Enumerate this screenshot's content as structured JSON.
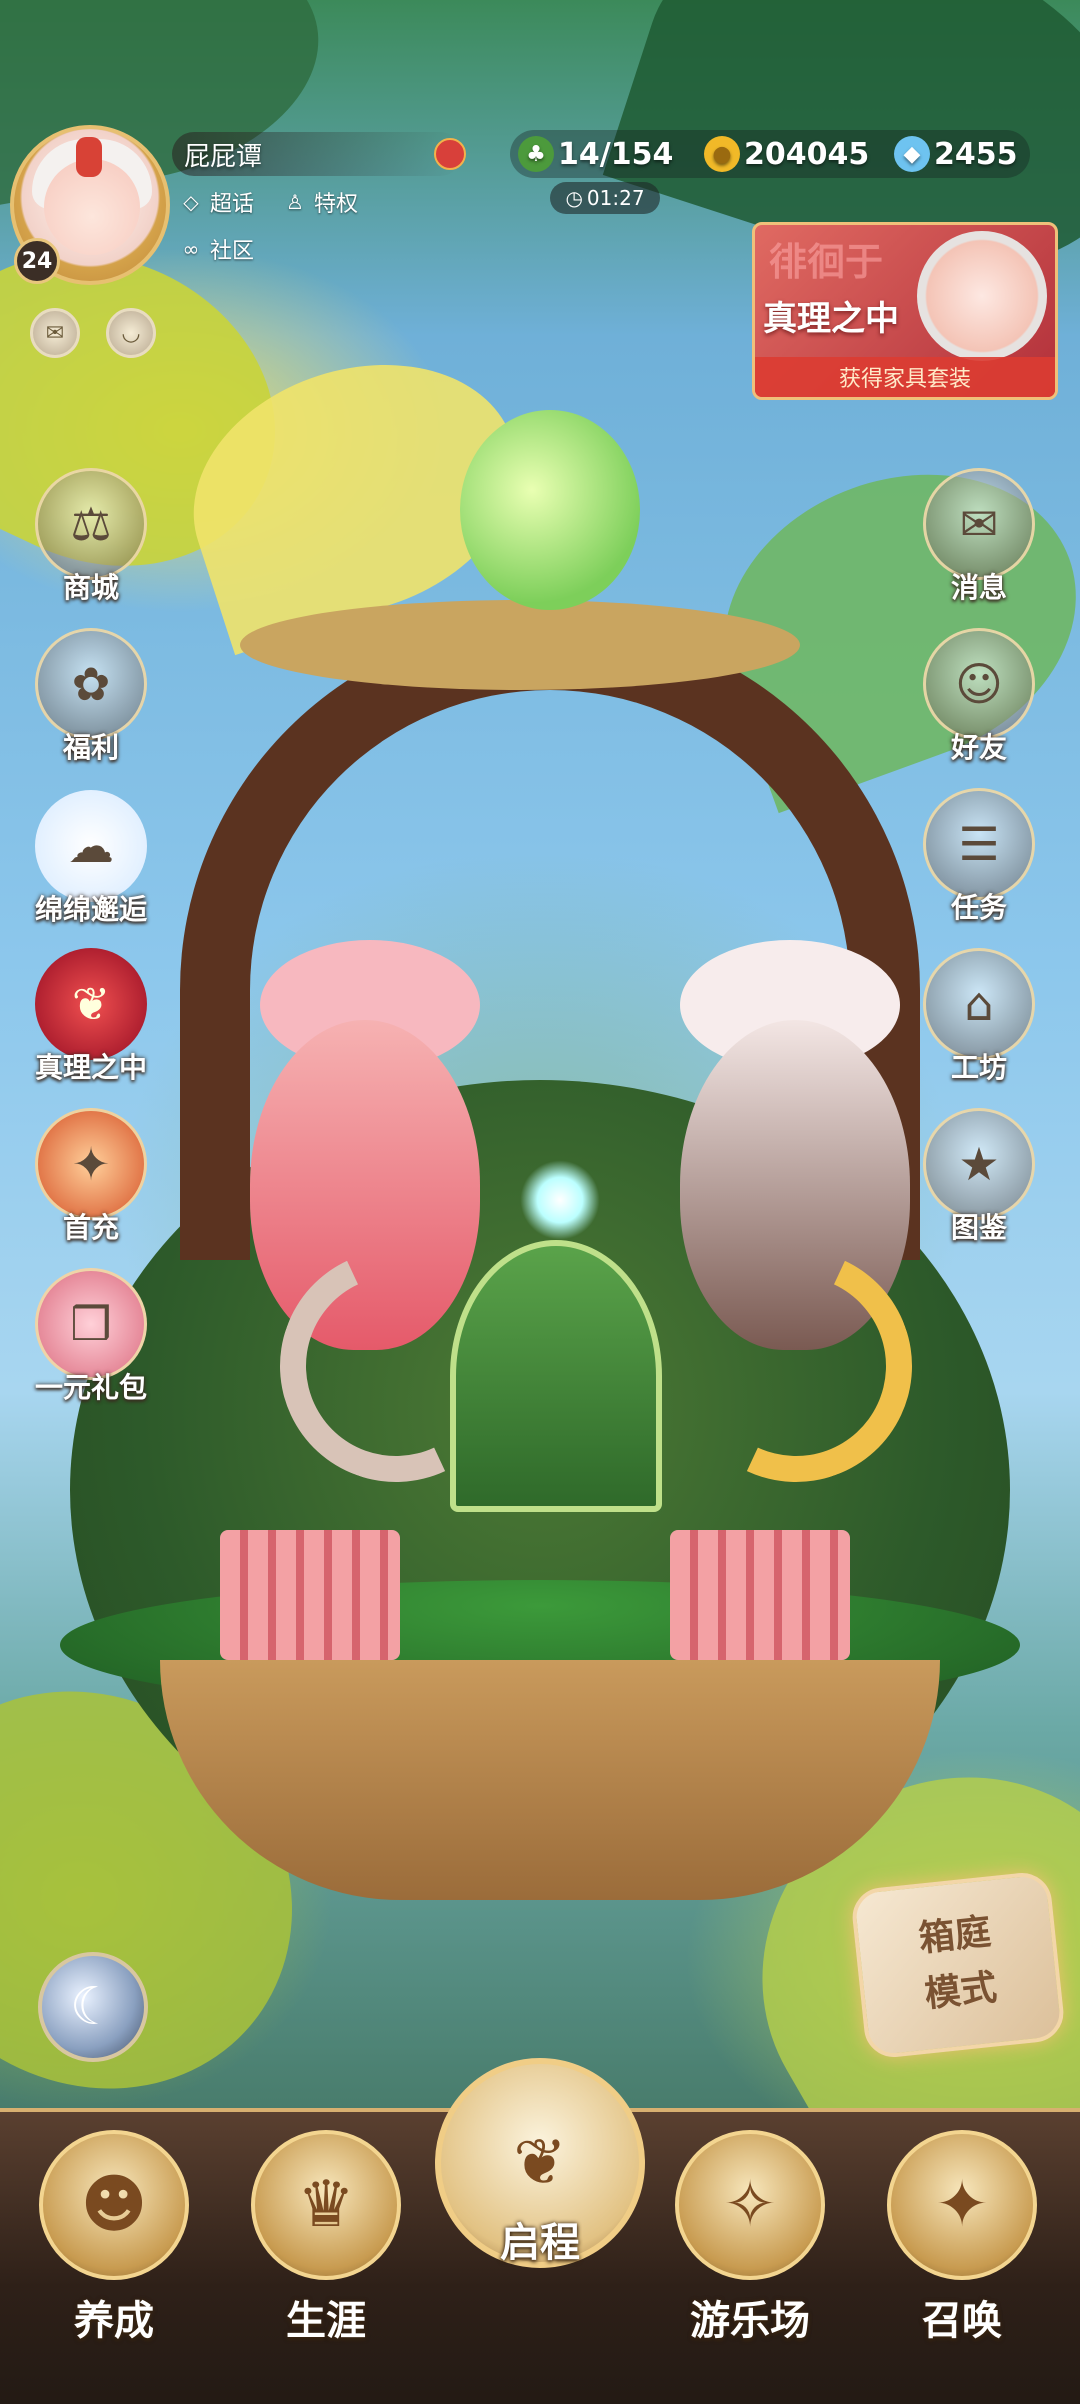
{
  "player": {
    "name": "屁屁谭",
    "level": "24",
    "tags": [
      {
        "label": "超话",
        "icon": "diamond-icon"
      },
      {
        "label": "特权",
        "icon": "crown-person-icon"
      },
      {
        "label": "社区",
        "icon": "mask-icon"
      }
    ]
  },
  "currencies": {
    "stamina": {
      "value": "14/154",
      "icon": "clover-icon",
      "color": "#5ab04a"
    },
    "gold": {
      "value": "204045",
      "icon": "gold-coin-icon",
      "color": "#f1b928"
    },
    "diamond": {
      "value": "2455",
      "icon": "diamond-gem-icon",
      "color": "#6ec3f0"
    },
    "timer": "01:27"
  },
  "banner": {
    "bg_text": "徘徊于",
    "title": "真理之中",
    "caption": "获得家具套装"
  },
  "left_menu": [
    {
      "label": "商城",
      "icon": "scales-icon"
    },
    {
      "label": "福利",
      "icon": "globe-gift-icon"
    },
    {
      "label": "绵绵邂逅",
      "icon": "cinnamoroll-icon"
    },
    {
      "label": "真理之中",
      "icon": "strawberry-icon"
    },
    {
      "label": "首充",
      "icon": "gift-bag-icon"
    },
    {
      "label": "一元礼包",
      "icon": "gift-box-icon"
    }
  ],
  "right_menu": [
    {
      "label": "消息",
      "icon": "envelope-icon"
    },
    {
      "label": "好友",
      "icon": "friends-icon"
    },
    {
      "label": "任务",
      "icon": "task-board-icon"
    },
    {
      "label": "工坊",
      "icon": "workshop-icon"
    },
    {
      "label": "图鉴",
      "icon": "album-icon"
    }
  ],
  "mode_button": {
    "line1": "箱庭",
    "line2": "模式"
  },
  "bottom_nav": [
    {
      "label": "养成",
      "icon": "girl-portrait-icon"
    },
    {
      "label": "生涯",
      "icon": "crown-icon"
    },
    {
      "label": "启程",
      "icon": "book-butterfly-icon"
    },
    {
      "label": "游乐场",
      "icon": "star-diamond-icon"
    },
    {
      "label": "召唤",
      "icon": "card-star-icon"
    }
  ]
}
